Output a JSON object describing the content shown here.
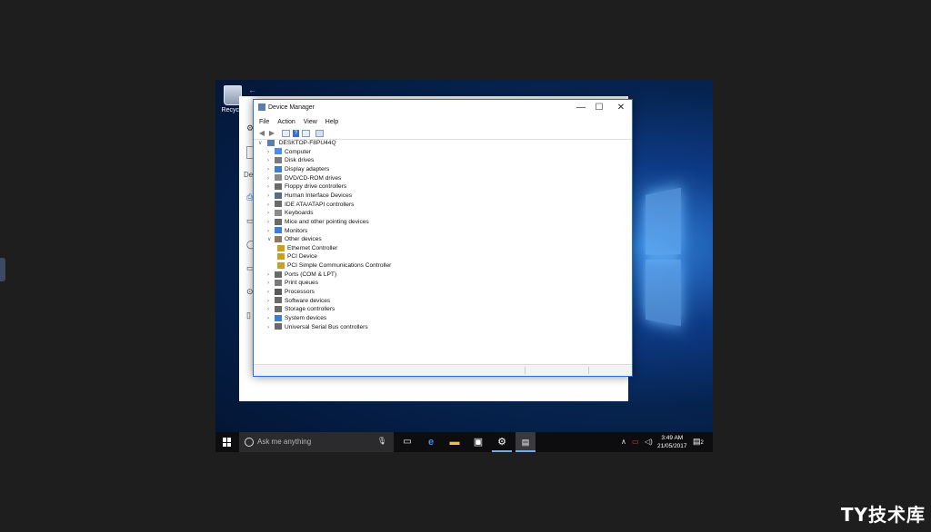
{
  "desktop": {
    "recycle_label": "Recycle"
  },
  "settings_partial": {
    "heading_fragment": "De"
  },
  "device_manager": {
    "title": "Device Manager",
    "minimize": "—",
    "maximize": "☐",
    "close": "✕",
    "menu": [
      "File",
      "Action",
      "View",
      "Help"
    ],
    "root": "DESKTOP-F8PU44Q",
    "categories": [
      {
        "label": "Computer",
        "expanded": false,
        "color": "#4a8fe0"
      },
      {
        "label": "Disk drives",
        "expanded": false,
        "color": "#7a7a7a"
      },
      {
        "label": "Display adapters",
        "expanded": false,
        "color": "#3c7fd0"
      },
      {
        "label": "DVD/CD-ROM drives",
        "expanded": false,
        "color": "#8a8a8a"
      },
      {
        "label": "Floppy drive controllers",
        "expanded": false,
        "color": "#6a6a6a"
      },
      {
        "label": "Human Interface Devices",
        "expanded": false,
        "color": "#5a6a80"
      },
      {
        "label": "IDE ATA/ATAPI controllers",
        "expanded": false,
        "color": "#6a6a6a"
      },
      {
        "label": "Keyboards",
        "expanded": false,
        "color": "#8a8a8a"
      },
      {
        "label": "Mice and other pointing devices",
        "expanded": false,
        "color": "#6a6a6a"
      },
      {
        "label": "Monitors",
        "expanded": false,
        "color": "#3c7fd0"
      },
      {
        "label": "Other devices",
        "expanded": true,
        "color": "#8a7a5a"
      },
      {
        "label": "Ethernet Controller",
        "child": true,
        "color": "#c9a020"
      },
      {
        "label": "PCI Device",
        "child": true,
        "color": "#c9a020"
      },
      {
        "label": "PCI Simple Communications Controller",
        "child": true,
        "color": "#c9a020"
      },
      {
        "label": "Ports (COM & LPT)",
        "expanded": false,
        "color": "#6a6a6a"
      },
      {
        "label": "Print queues",
        "expanded": false,
        "color": "#7a7a7a"
      },
      {
        "label": "Processors",
        "expanded": false,
        "color": "#5a5a5a"
      },
      {
        "label": "Software devices",
        "expanded": false,
        "color": "#6a6a6a"
      },
      {
        "label": "Storage controllers",
        "expanded": false,
        "color": "#6a6a6a"
      },
      {
        "label": "System devices",
        "expanded": false,
        "color": "#3c7fd0"
      },
      {
        "label": "Universal Serial Bus controllers",
        "expanded": false,
        "color": "#6a6a6a"
      }
    ]
  },
  "taskbar": {
    "search_placeholder": "Ask me anything",
    "time": "3:49 AM",
    "date": "21/05/2017",
    "notification_count": "2"
  },
  "watermark": "TY技术库"
}
